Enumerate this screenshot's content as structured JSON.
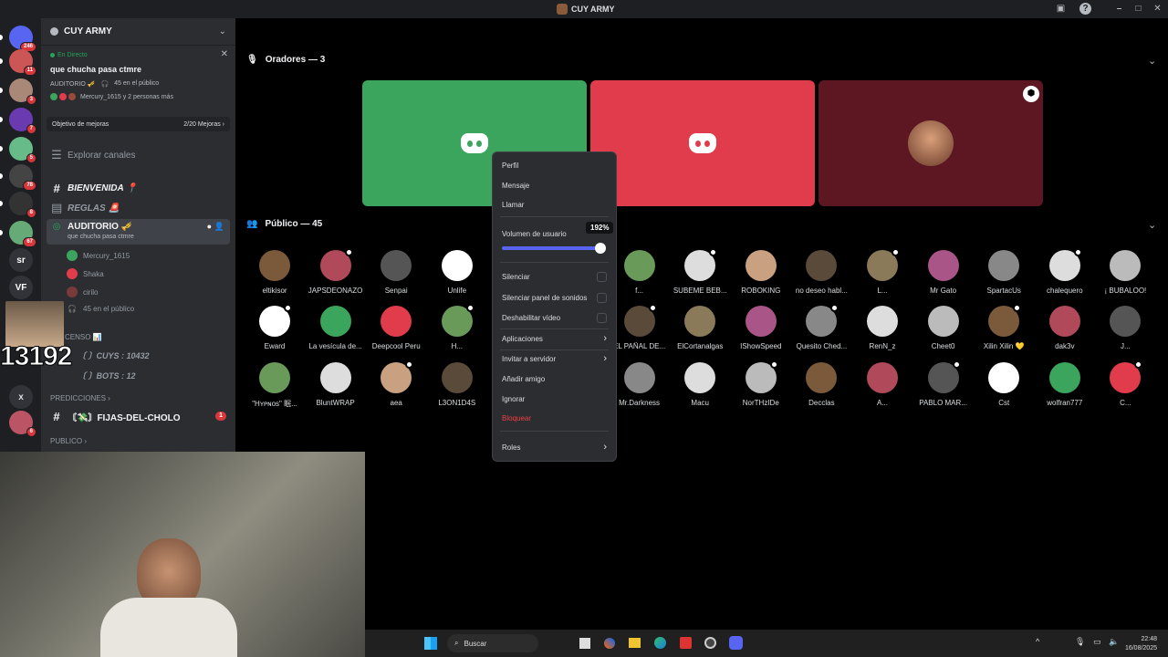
{
  "window": {
    "title": "CUY ARMY"
  },
  "rail": {
    "servers": [
      {
        "label": "246",
        "badge": "246",
        "color": "#5865f2"
      },
      {
        "label": "",
        "badge": "11",
        "color": "#c55"
      },
      {
        "label": "",
        "badge": "3",
        "color": "#a87"
      },
      {
        "label": "",
        "badge": "7",
        "color": "#6a3ab0"
      },
      {
        "label": "",
        "badge": "5",
        "color": "#6b8"
      },
      {
        "label": "",
        "badge": "78",
        "color": "#444"
      },
      {
        "label": "",
        "badge": "8",
        "color": "#333"
      },
      {
        "label": "",
        "badge": "67",
        "color": "#6a7"
      },
      {
        "label": "sr",
        "badge": "",
        "color": "#313338"
      },
      {
        "label": "VF",
        "badge": "",
        "color": "#313338"
      }
    ],
    "x_label": "x",
    "bottom_badge": "6"
  },
  "sidebar": {
    "server_name": "CUY ARMY",
    "live": {
      "status": "En Directo",
      "title": "que chucha pasa ctmre",
      "stage": "AUDITORIO 🎺",
      "audience": "45 en el público",
      "speakers": "Mercury_1615 y 2 personas más"
    },
    "boost": {
      "label": "Objetivo de mejoras",
      "progress": "2/20 Mejoras"
    },
    "explore": "Explorar canales",
    "channels": [
      "BIENVENIDA 📍",
      "REGLAS 🚨"
    ],
    "stage_channel": {
      "name": "AUDITORIO 🎺",
      "topic": "que chucha pasa ctmre"
    },
    "stage_members": [
      "Mercury_1615",
      "Shaka",
      "cirilo"
    ],
    "stage_audience": "45 en el público",
    "censo_category": "CENSO 📊",
    "cuys": "〔 〕CUYS : 10432",
    "bots": "〔 〕BOTS : 12",
    "predicciones": "PREDICCIONES",
    "fijas": "〘💸〙FIJAS-DEL-CHOLO",
    "fijas_badge": "1",
    "publico": "PUBLICO",
    "overlay_number": "13192"
  },
  "stage": {
    "speakers_header": "Oradores — 3",
    "public_header": "Público — 45",
    "tiles": [
      {
        "color": "#3ba55d"
      },
      {
        "color": "#e13c4c"
      },
      {
        "color": "#5c1722"
      }
    ]
  },
  "members": [
    [
      "eltikisor",
      "JAPSDEONAZO",
      "Senpai",
      "Unlife",
      "",
      "",
      "f...",
      "SUBEME BEB...",
      "ROBOKING",
      "no deseo habl...",
      "L...",
      "Mr Gato",
      "SpartacUs",
      "chalequero",
      "¡ BUBALOO!"
    ],
    [
      "Eward",
      "La vesícula de...",
      "Deepcool Peru",
      "H...",
      "",
      "",
      "EL PAÑAL DE...",
      "ElCortanalgas",
      "IShowSpeed",
      "Quesito Ched...",
      "RenN_z",
      "Cheet0",
      "Xilin Xilin 💛",
      "dak3v",
      "J..."
    ],
    [
      "\"Hʏᴘɴᴏs\" 眠...",
      "BluntWRAP",
      "aea",
      "L3ON1D4S",
      "",
      "",
      "Mr.Darkness",
      "Macu",
      "NorTHzIDe",
      "Decclas",
      "A...",
      "PABLO MAR...",
      "Cst",
      "wolfran777",
      "C..."
    ]
  ],
  "context_menu": {
    "items_top": [
      "Perfil",
      "Mensaje",
      "Llamar"
    ],
    "volume_label": "Volumen de usuario",
    "volume_value": "192%",
    "volume_fraction": 0.96,
    "checkbox_items": [
      "Silenciar",
      "Silenciar panel de sonidos",
      "Deshabilitar vídeo"
    ],
    "submenu_items": [
      "Aplicaciones",
      "Invitar a servidor"
    ],
    "items_mid": [
      "Añadir amigo",
      "Ignorar"
    ],
    "danger_item": "Bloquear",
    "roles": "Roles"
  },
  "taskbar": {
    "search": "Buscar",
    "time": "22:48",
    "date": "16/08/2025"
  },
  "colors": {
    "blurple": "#5865f2",
    "danger": "#f23f43",
    "green": "#3ba55d",
    "red": "#e13c4c"
  }
}
